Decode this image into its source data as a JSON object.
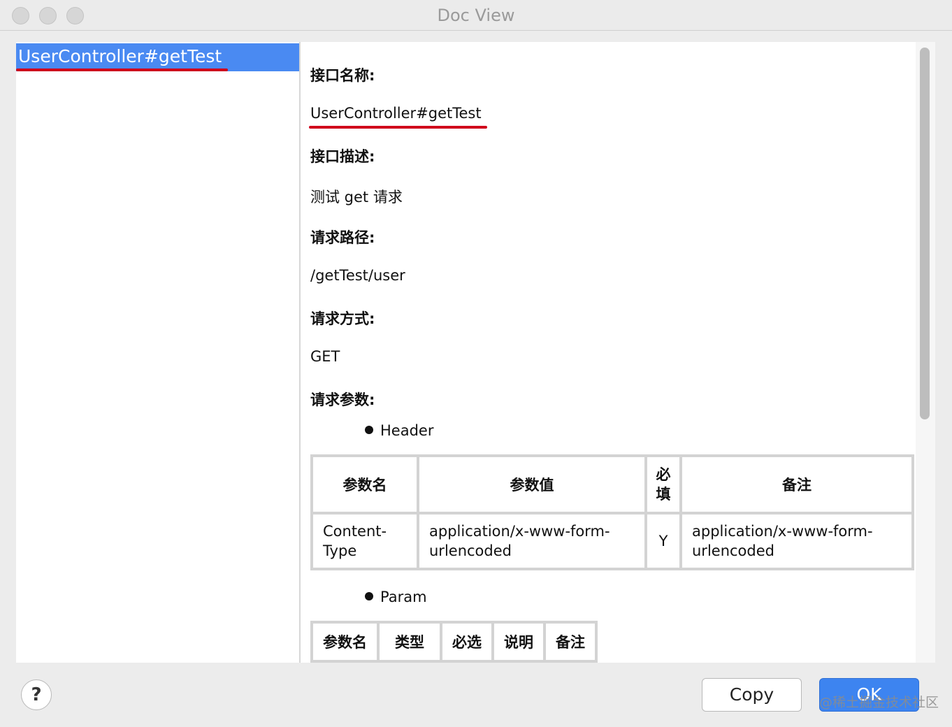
{
  "window": {
    "title": "Doc View"
  },
  "tree": {
    "selected_item": "UserController#getTest"
  },
  "doc": {
    "name_label": "接口名称:",
    "name_value": "UserController#getTest",
    "desc_label": "接口描述:",
    "desc_value": "测试 get 请求",
    "path_label": "请求路径:",
    "path_value": "/getTest/user",
    "method_label": "请求方式:",
    "method_value": "GET",
    "params_label": "请求参数:",
    "header_section": "Header",
    "header_table": {
      "columns": [
        "参数名",
        "参数值",
        "必填",
        "备注"
      ],
      "rows": [
        [
          "Content-Type",
          "application/x-www-form-urlencoded",
          "Y",
          "application/x-www-form-urlencoded"
        ]
      ]
    },
    "param_section": "Param",
    "param_table": {
      "columns": [
        "参数名",
        "类型",
        "必选",
        "说明",
        "备注"
      ]
    }
  },
  "footer": {
    "help_label": "?",
    "copy_label": "Copy",
    "ok_label": "OK",
    "watermark": "@稀土掘金技术社区"
  },
  "colors": {
    "selection": "#4a8af2",
    "underline": "#d0021b",
    "ok_button": "#3d84f0"
  }
}
